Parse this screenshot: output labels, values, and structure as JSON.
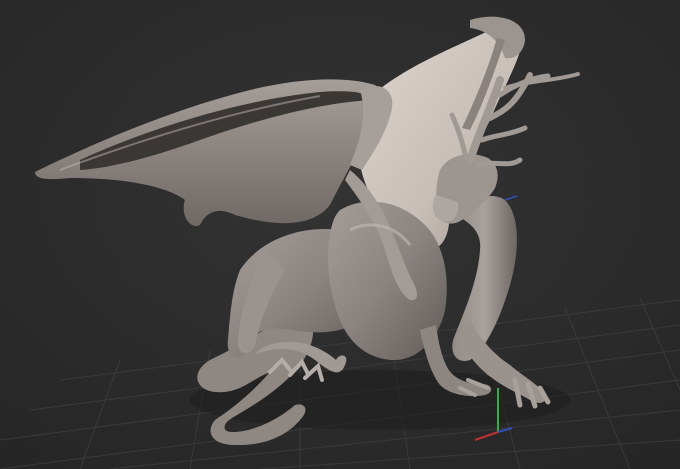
{
  "viewport": {
    "background": "#2b2b2b",
    "grid_line_color": "#3d3d3d",
    "model_color": "#8f8884",
    "model_highlight": "#c6beb8",
    "model_shadow": "#4f4a47",
    "wing_membrane_light": "#d2cac3",
    "gizmo_colors": {
      "x_axis": "#c03030",
      "y_axis": "#30b040",
      "z_axis": "#3050c0"
    },
    "scene_object": "dragon-sculpt",
    "render_mode": "matcap-clay"
  }
}
